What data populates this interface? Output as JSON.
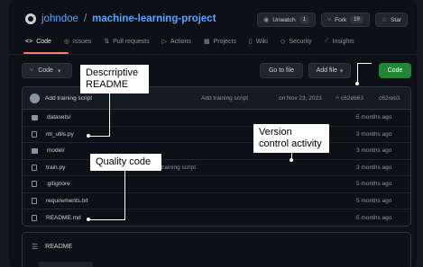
{
  "repo": {
    "owner": "johndoe",
    "separator": "/",
    "name": "machine-learning-project"
  },
  "header_buttons": [
    {
      "label": "Unwatch",
      "count": "1",
      "icon": "eye-icon"
    },
    {
      "label": "Fork",
      "count": "19",
      "icon": "fork-icon"
    },
    {
      "label": "Star",
      "count": "",
      "icon": "star-icon"
    }
  ],
  "tabs": [
    {
      "label": "Code",
      "icon": "code-icon",
      "active": true
    },
    {
      "label": "Issues",
      "icon": "issue-icon"
    },
    {
      "label": "Pull requests",
      "icon": "pull-request-icon"
    },
    {
      "label": "Actions",
      "icon": "play-icon"
    },
    {
      "label": "Projects",
      "icon": "table-icon"
    },
    {
      "label": "Wiki",
      "icon": "book-icon"
    },
    {
      "label": "Security",
      "icon": "shield-icon"
    },
    {
      "label": "Insights",
      "icon": "graph-icon"
    }
  ],
  "toolbar": {
    "branch_label": "Code",
    "goto_label": "Go to file",
    "addfile_label": "Add file",
    "code_label": "Code"
  },
  "commit": {
    "message": "Add training script",
    "message2": "Add training script",
    "date": "on Nov 23, 2023",
    "hash": "c62eb63",
    "hash2": "c62reb3"
  },
  "files": [
    {
      "name": "datasets/",
      "type": "dir",
      "message": "",
      "time": "5 months ago"
    },
    {
      "name": "ml_utils.py",
      "type": "file",
      "message": "",
      "time": "3 months ago"
    },
    {
      "name": "model/",
      "type": "dir",
      "message": "",
      "time": "3 months ago"
    },
    {
      "name": "train.py",
      "type": "file",
      "message": "Add training script",
      "time": "3 months ago"
    },
    {
      "name": ".gitignore",
      "type": "file",
      "message": "",
      "time": "5 months ago"
    },
    {
      "name": "requirements.txt",
      "type": "file",
      "message": "",
      "time": "5 months ago"
    },
    {
      "name": "README.md",
      "type": "file",
      "message": "",
      "time": "5 months ago"
    }
  ],
  "readme": {
    "title": "README"
  },
  "annotations": {
    "readme_note": "Descrriptive README",
    "quality_note": "Quality code",
    "version_note": "Version control activity"
  },
  "colors": {
    "accent": "#58a6ff",
    "green": "#238636",
    "tab_underline": "#f78166",
    "bg": "#0d1117"
  }
}
